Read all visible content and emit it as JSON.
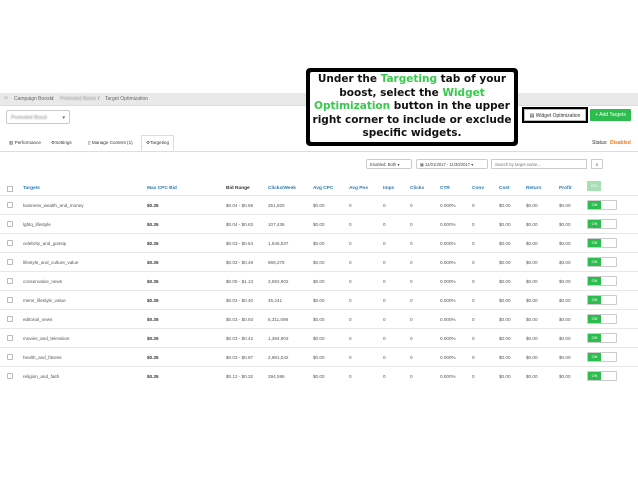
{
  "breadcrumb": {
    "items": [
      "Campaign Boosts",
      "Promoted Boost",
      "Target Optimization"
    ],
    "separator": "/"
  },
  "boost_select": {
    "value": "Promoted Boost"
  },
  "buttons": {
    "widget_optimization": "Widget Optimization",
    "add_targets": "+ Add Targets"
  },
  "tabs": [
    {
      "label": "Performance",
      "icon": "bar-chart-icon"
    },
    {
      "label": "Settings",
      "icon": "gear-icon"
    },
    {
      "label": "Manage Content (1)",
      "icon": "document-icon"
    },
    {
      "label": "Targeting",
      "icon": "gear-icon",
      "active": true
    }
  ],
  "status": {
    "label": "Status:",
    "value": "Disabled",
    "color": "#e67e22"
  },
  "filters": {
    "enabled": "Enabled: Both",
    "date_range": "11/01/2017 - 11/30/2017",
    "search_placeholder": "Search by target name..."
  },
  "table": {
    "headers": {
      "targets": "Targets",
      "max_cpc_bid": "Max CPC Bid",
      "bid_range": "Bid Range",
      "clicks_week": "Clicks/Week",
      "avg_cpc": "Avg CPC",
      "avg_pos": "Avg Pos",
      "imps": "Imps",
      "clicks": "Clicks",
      "ctr": "CTR",
      "conv": "Conv",
      "cost": "Cost",
      "return": "Return",
      "profit": "Profit",
      "toggle": "ON"
    },
    "rows": [
      {
        "target": "business_wealth_and_money",
        "bid": "$0.35",
        "range": "$0.04 - $0.69",
        "cw": "251,820",
        "avgcpc": "$0.00",
        "avgpos": "0",
        "imps": "0",
        "clicks": "0",
        "ctr": "0.000%",
        "conv": "0",
        "cost": "$0.00",
        "ret": "$0.00",
        "profit": "$0.00",
        "on": "ON"
      },
      {
        "target": "lgbtq_lifestyle",
        "bid": "$0.35",
        "range": "$0.04 - $0.63",
        "cw": "107,436",
        "avgcpc": "$0.00",
        "avgpos": "0",
        "imps": "0",
        "clicks": "0",
        "ctr": "0.000%",
        "conv": "0",
        "cost": "$0.00",
        "ret": "$0.00",
        "profit": "$0.00",
        "on": "ON"
      },
      {
        "target": "celebrity_and_gossip",
        "bid": "$0.35",
        "range": "$0.03 - $0.64",
        "cw": "1,845,537",
        "avgcpc": "$0.00",
        "avgpos": "0",
        "imps": "0",
        "clicks": "0",
        "ctr": "0.000%",
        "conv": "0",
        "cost": "$0.00",
        "ret": "$0.00",
        "profit": "$0.00",
        "on": "ON"
      },
      {
        "target": "lifestyle_and_culture_value",
        "bid": "$0.35",
        "range": "$0.02 - $0.49",
        "cw": "869,278",
        "avgcpc": "$0.00",
        "avgpos": "0",
        "imps": "0",
        "clicks": "0",
        "ctr": "0.000%",
        "conv": "0",
        "cost": "$0.00",
        "ret": "$0.00",
        "profit": "$0.00",
        "on": "ON"
      },
      {
        "target": "conservative_news",
        "bid": "$0.35",
        "range": "$0.05 - $1.13",
        "cw": "3,592,902",
        "avgcpc": "$0.00",
        "avgpos": "0",
        "imps": "0",
        "clicks": "0",
        "ctr": "0.000%",
        "conv": "0",
        "cost": "$0.00",
        "ret": "$0.00",
        "profit": "$0.00",
        "on": "ON"
      },
      {
        "target": "mens_lifestyle_value",
        "bid": "$0.35",
        "range": "$0.02 - $0.40",
        "cw": "45,241",
        "avgcpc": "$0.00",
        "avgpos": "0",
        "imps": "0",
        "clicks": "0",
        "ctr": "0.000%",
        "conv": "0",
        "cost": "$0.00",
        "ret": "$0.00",
        "profit": "$0.00",
        "on": "ON"
      },
      {
        "target": "editorial_news",
        "bid": "$0.35",
        "range": "$0.03 - $0.93",
        "cw": "5,311,098",
        "avgcpc": "$0.00",
        "avgpos": "0",
        "imps": "0",
        "clicks": "0",
        "ctr": "0.000%",
        "conv": "0",
        "cost": "$0.00",
        "ret": "$0.00",
        "profit": "$0.00",
        "on": "ON"
      },
      {
        "target": "movies_and_television",
        "bid": "$0.35",
        "range": "$0.03 - $0.42",
        "cw": "1,394,903",
        "avgcpc": "$0.00",
        "avgpos": "0",
        "imps": "0",
        "clicks": "0",
        "ctr": "0.000%",
        "conv": "0",
        "cost": "$0.00",
        "ret": "$0.00",
        "profit": "$0.00",
        "on": "ON"
      },
      {
        "target": "health_and_fitness",
        "bid": "$0.35",
        "range": "$0.03 - $0.97",
        "cw": "2,981,042",
        "avgcpc": "$0.00",
        "avgpos": "0",
        "imps": "0",
        "clicks": "0",
        "ctr": "0.000%",
        "conv": "0",
        "cost": "$0.00",
        "ret": "$0.00",
        "profit": "$0.00",
        "on": "ON"
      },
      {
        "target": "religion_and_faith",
        "bid": "$0.35",
        "range": "$0.12 - $0.32",
        "cw": "294,596",
        "avgcpc": "$0.00",
        "avgpos": "0",
        "imps": "0",
        "clicks": "0",
        "ctr": "0.000%",
        "conv": "0",
        "cost": "$0.00",
        "ret": "$0.00",
        "profit": "$0.00",
        "on": "ON"
      }
    ]
  },
  "callout": {
    "p1": "Under the ",
    "hl1": "Targeting",
    "p2": " tab of your boost, select the ",
    "hl2": "Widget Optimization",
    "p3": " button in the upper right corner to include or exclude specific widgets."
  },
  "colors": {
    "accent_green": "#2dbd4f",
    "link_blue": "#2a7ab8",
    "highlight_green": "#37c94b"
  }
}
